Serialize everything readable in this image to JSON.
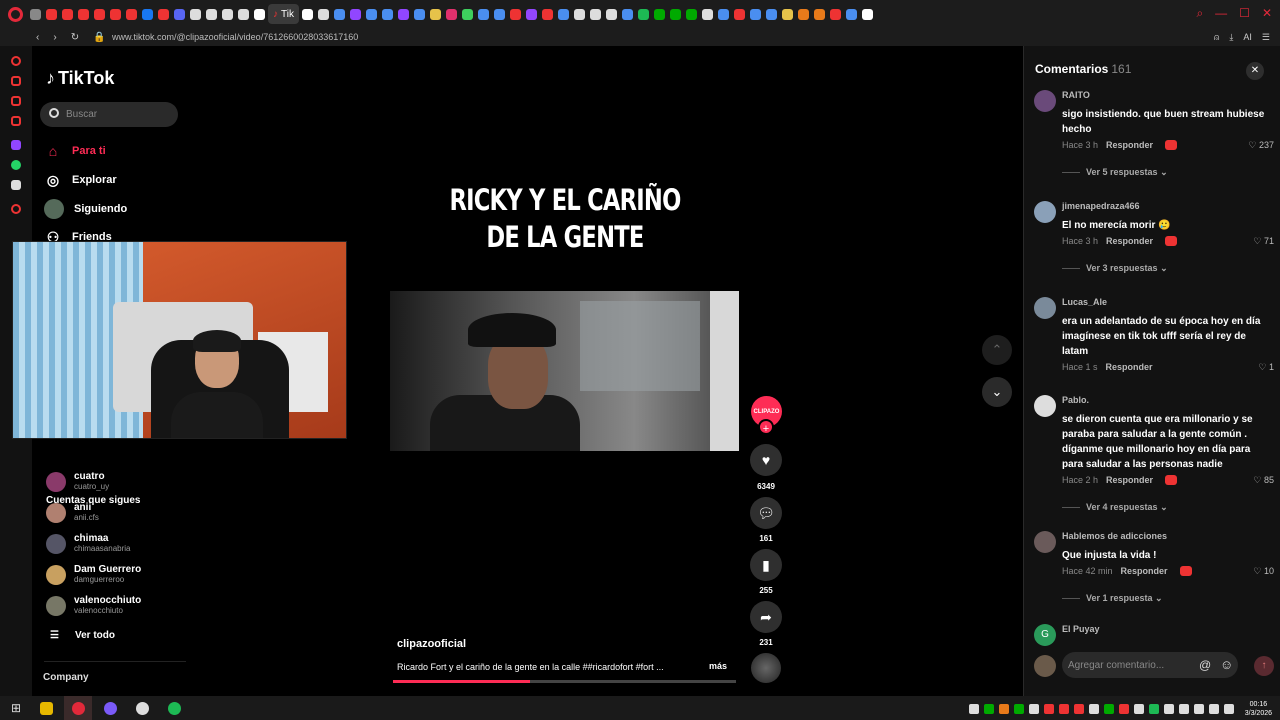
{
  "browser": {
    "active_tab_title": "Tik",
    "url": "www.tiktok.com/@clipazooficial/video/7612660028033617160",
    "ai_label": "AI",
    "tab_icon_colors": [
      "#888",
      "#e33",
      "#e33",
      "#e33",
      "#e33",
      "#e33",
      "#e33",
      "#1877f2",
      "#e33",
      "#5865f2",
      "#ddd",
      "#ddd",
      "#ddd",
      "#ddd",
      "#fff",
      "#fff",
      "#e33"
    ],
    "tab_icon_colors_right": [
      "#fff",
      "#ddd",
      "#4a8ef0",
      "#9146ff",
      "#4a8ef0",
      "#4a8ef0",
      "#9146ff",
      "#4a8ef0",
      "#e6c34a",
      "#e1306c",
      "#3ecf5e",
      "#4a8ef0",
      "#4a8ef0",
      "#e33",
      "#9146ff",
      "#e33",
      "#4a8ef0",
      "#ddd",
      "#ddd",
      "#ddd",
      "#4a8ef0",
      "#1db954",
      "#0a0",
      "#0a0",
      "#0a0",
      "#ddd",
      "#4a8ef0",
      "#e33",
      "#4a8ef0",
      "#4a8ef0",
      "#e6c34a",
      "#e87a1a",
      "#e87a1a",
      "#e33",
      "#4a8ef0",
      "#fff"
    ]
  },
  "sidebar": {
    "logo": "TikTok",
    "search_placeholder": "Buscar",
    "menu": [
      {
        "label": "Para ti",
        "icon": "home-icon"
      },
      {
        "label": "Explorar",
        "icon": "compass-icon"
      },
      {
        "label": "Siguiendo",
        "icon": "following-icon"
      },
      {
        "label": "Friends",
        "icon": "friends-icon"
      }
    ],
    "following_title": "Cuentas que sigues",
    "accounts": [
      {
        "name": "cuatro",
        "handle": "cuatro_uy",
        "color": "#8a3a6a"
      },
      {
        "name": "anii",
        "handle": "anii.cfs",
        "color": "#b08070"
      },
      {
        "name": "chimaa",
        "handle": "chimaasanabria",
        "color": "#556"
      },
      {
        "name": "Dam Guerrero",
        "handle": "damguerreroo",
        "color": "#c8a060"
      },
      {
        "name": "valenocchiuto",
        "handle": "valenocchiuto",
        "color": "#776"
      }
    ],
    "see_all": "Ver todo",
    "company": "Company"
  },
  "video": {
    "headline_line1": "RICKY Y EL CARIÑO",
    "headline_line2": "DE LA GENTE",
    "author": "clipazooficial",
    "description": "Ricardo Fort y el cariño de la gente en la calle ##ricardofort #fort ...",
    "more": "más",
    "progress": 0.4,
    "creator_badge": "CLIPAZO",
    "likes": "6349",
    "comments": "161",
    "saves": "255",
    "shares": "231"
  },
  "comments_panel": {
    "title": "Comentarios",
    "count": "161",
    "reply_label": "Responder",
    "input_placeholder": "Agregar comentario...",
    "items": [
      {
        "user": "RAITO",
        "text": "sigo insistiendo. que buen stream hubiese hecho",
        "time": "Hace 3 h",
        "likes": "237",
        "replies": "Ver 5 respuestas",
        "badge": true,
        "color": "#6a4a7a"
      },
      {
        "user": "jimenapedraza466",
        "text": "El no merecía morir 🥲",
        "time": "Hace 3 h",
        "likes": "71",
        "replies": "Ver 3 respuestas",
        "badge": true,
        "color": "#8aa0b8"
      },
      {
        "user": "Lucas_Ale",
        "text": "era un adelantado de su época hoy en día imagínese en tik tok ufff sería el rey de latam",
        "time": "Hace 1 s",
        "likes": "1",
        "replies": "",
        "badge": false,
        "color": "#7a8a9a"
      },
      {
        "user": "Pablo.",
        "text": "se dieron cuenta que era millonario y se paraba para saludar a la gente común . díganme que millonario hoy en día para para saludar a las personas nadie",
        "time": "Hace 2 h",
        "likes": "85",
        "replies": "Ver 4 respuestas",
        "badge": true,
        "color": "#ddd"
      },
      {
        "user": "Hablemos de adicciones",
        "text": "Que injusta la vida !",
        "time": "Hace 42 min",
        "likes": "10",
        "replies": "Ver 1 respuesta",
        "badge": true,
        "color": "#6a5a5a"
      },
      {
        "user": "El Puyay",
        "text": "",
        "time": "",
        "likes": "",
        "replies": "",
        "badge": false,
        "color": "#2a9a5a",
        "initial": "G"
      }
    ]
  },
  "taskbar": {
    "time": "00:16",
    "date": "3/3/2026",
    "app_colors": [
      "#e6b800",
      "#e3293a",
      "#7a5af8",
      "#ddd",
      "#1db954"
    ],
    "tray_colors": [
      "#ddd",
      "#0a0",
      "#e87a1a",
      "#0a0",
      "#ddd",
      "#e33",
      "#e33",
      "#e33",
      "#ddd",
      "#0a0",
      "#e33",
      "#ddd",
      "#1db954",
      "#ddd",
      "#ddd",
      "#ddd",
      "#ddd",
      "#ddd"
    ]
  }
}
